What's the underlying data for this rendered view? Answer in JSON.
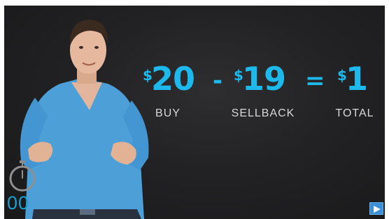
{
  "equation": {
    "currency_symbol": "$",
    "buy": {
      "amount": "20",
      "label": "BUY"
    },
    "minus": "-",
    "sellback": {
      "amount": "19",
      "label": "SELLBACK"
    },
    "equals": "=",
    "total": {
      "amount": "1",
      "label": "TOTAL"
    }
  },
  "timer": {
    "digits": "00"
  },
  "icons": {
    "stopwatch": "stopwatch-icon",
    "play": "play-icon"
  },
  "colors": {
    "accent": "#1db9ec",
    "background": "#222224",
    "caption": "#d8d8d8"
  }
}
